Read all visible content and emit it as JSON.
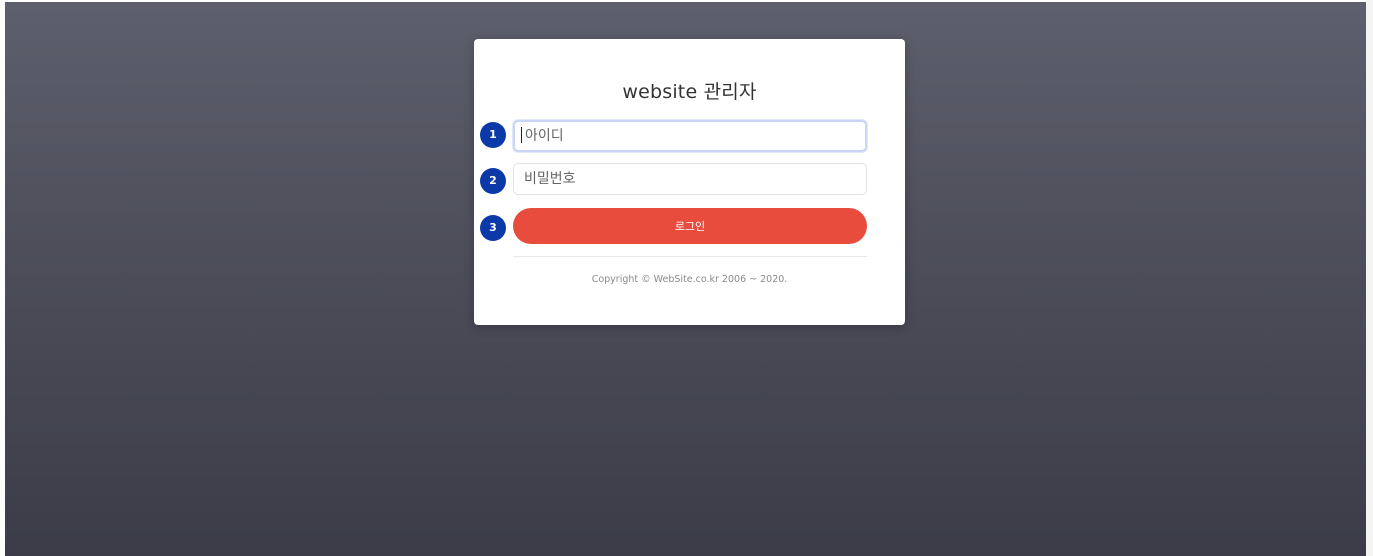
{
  "login": {
    "title": "website 관리자",
    "id_placeholder": "아이디",
    "password_placeholder": "비밀번호",
    "login_label": "로그인",
    "copyright": "Copyright © WebSite.co.kr 2006 ~ 2020."
  },
  "annotations": {
    "badge_1": "1",
    "badge_2": "2",
    "badge_3": "3"
  },
  "colors": {
    "login_button": "#e84c3d",
    "badge": "#0b3aa8",
    "background_top": "#5e5f6c",
    "background_bottom": "#3b3c47"
  }
}
